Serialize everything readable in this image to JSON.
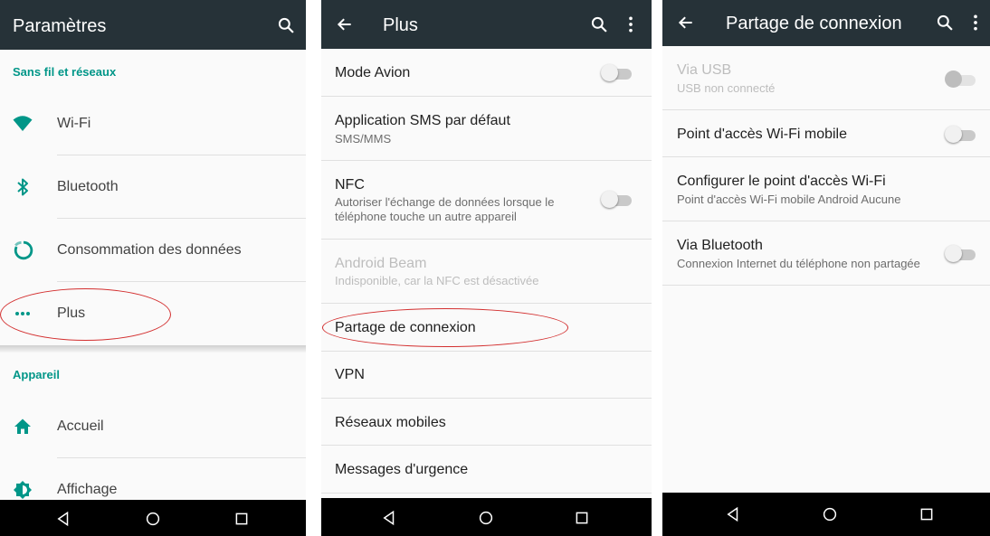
{
  "panel1": {
    "title": "Paramètres",
    "section_wireless": "Sans fil et réseaux",
    "items": [
      {
        "label": "Wi-Fi",
        "icon": "wifi-icon"
      },
      {
        "label": "Bluetooth",
        "icon": "bluetooth-icon"
      },
      {
        "label": "Consommation des données",
        "icon": "data-usage-icon"
      },
      {
        "label": "Plus",
        "icon": "more-horiz-icon"
      }
    ],
    "section_device": "Appareil",
    "device_items": [
      {
        "label": "Accueil",
        "icon": "home-icon"
      },
      {
        "label": "Affichage",
        "icon": "brightness-icon"
      }
    ]
  },
  "panel2": {
    "title": "Plus",
    "items": [
      {
        "label": "Mode Avion",
        "toggle": "off"
      },
      {
        "label": "Application SMS par défaut",
        "sub": "SMS/MMS"
      },
      {
        "label": "NFC",
        "sub1": "Autoriser l'échange de données lorsque le",
        "sub2": "téléphone touche un autre appareil",
        "toggle": "off"
      },
      {
        "label": "Android Beam",
        "sub": "Indisponible, car la NFC est désactivée",
        "disabled": true
      },
      {
        "label": "Partage de connexion"
      },
      {
        "label": "VPN"
      },
      {
        "label": "Réseaux mobiles"
      },
      {
        "label": "Messages d'urgence"
      }
    ]
  },
  "panel3": {
    "title": "Partage de connexion",
    "items": [
      {
        "label": "Via USB",
        "sub": "USB non connecté",
        "toggle": "off",
        "disabled": true
      },
      {
        "label": "Point d'accès Wi-Fi mobile",
        "toggle": "off"
      },
      {
        "label": "Configurer le point d'accès Wi-Fi",
        "sub": "Point d'accès Wi-Fi mobile Android Aucune"
      },
      {
        "label": "Via Bluetooth",
        "sub": "Connexion Internet du téléphone non partagée",
        "toggle": "off"
      }
    ]
  },
  "colors": {
    "appbar": "#263238",
    "accent": "#009688",
    "highlight_oval": "#d32f2f",
    "navbar": "#000000"
  }
}
